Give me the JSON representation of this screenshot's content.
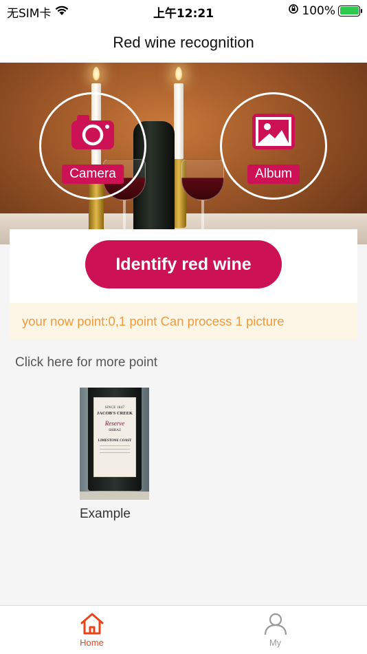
{
  "status_bar": {
    "carrier": "无SIM卡",
    "time": "上午12:21",
    "battery": "100%"
  },
  "nav": {
    "title": "Red wine recognition"
  },
  "hero": {
    "camera_label": "Camera",
    "album_label": "Album"
  },
  "identify_button": "Identify red wine",
  "points_text": "your now point:0,1 point Can process 1 picture",
  "more_point_link": "Click here for more point",
  "example": {
    "label": "Example",
    "wine_label_lines": [
      "SINCE 1847",
      "JACOB'S CREEK",
      "Reserve",
      "SHIRAZ",
      "LIMESTONE COAST"
    ]
  },
  "tabs": [
    {
      "label": "Home",
      "icon": "home-icon",
      "active": true
    },
    {
      "label": "My",
      "icon": "person-icon",
      "active": false
    }
  ],
  "colors": {
    "accent": "#cc1155",
    "tab_active": "#e8431a",
    "points_text": "#f0993a",
    "points_bg": "#fdf6e6"
  }
}
